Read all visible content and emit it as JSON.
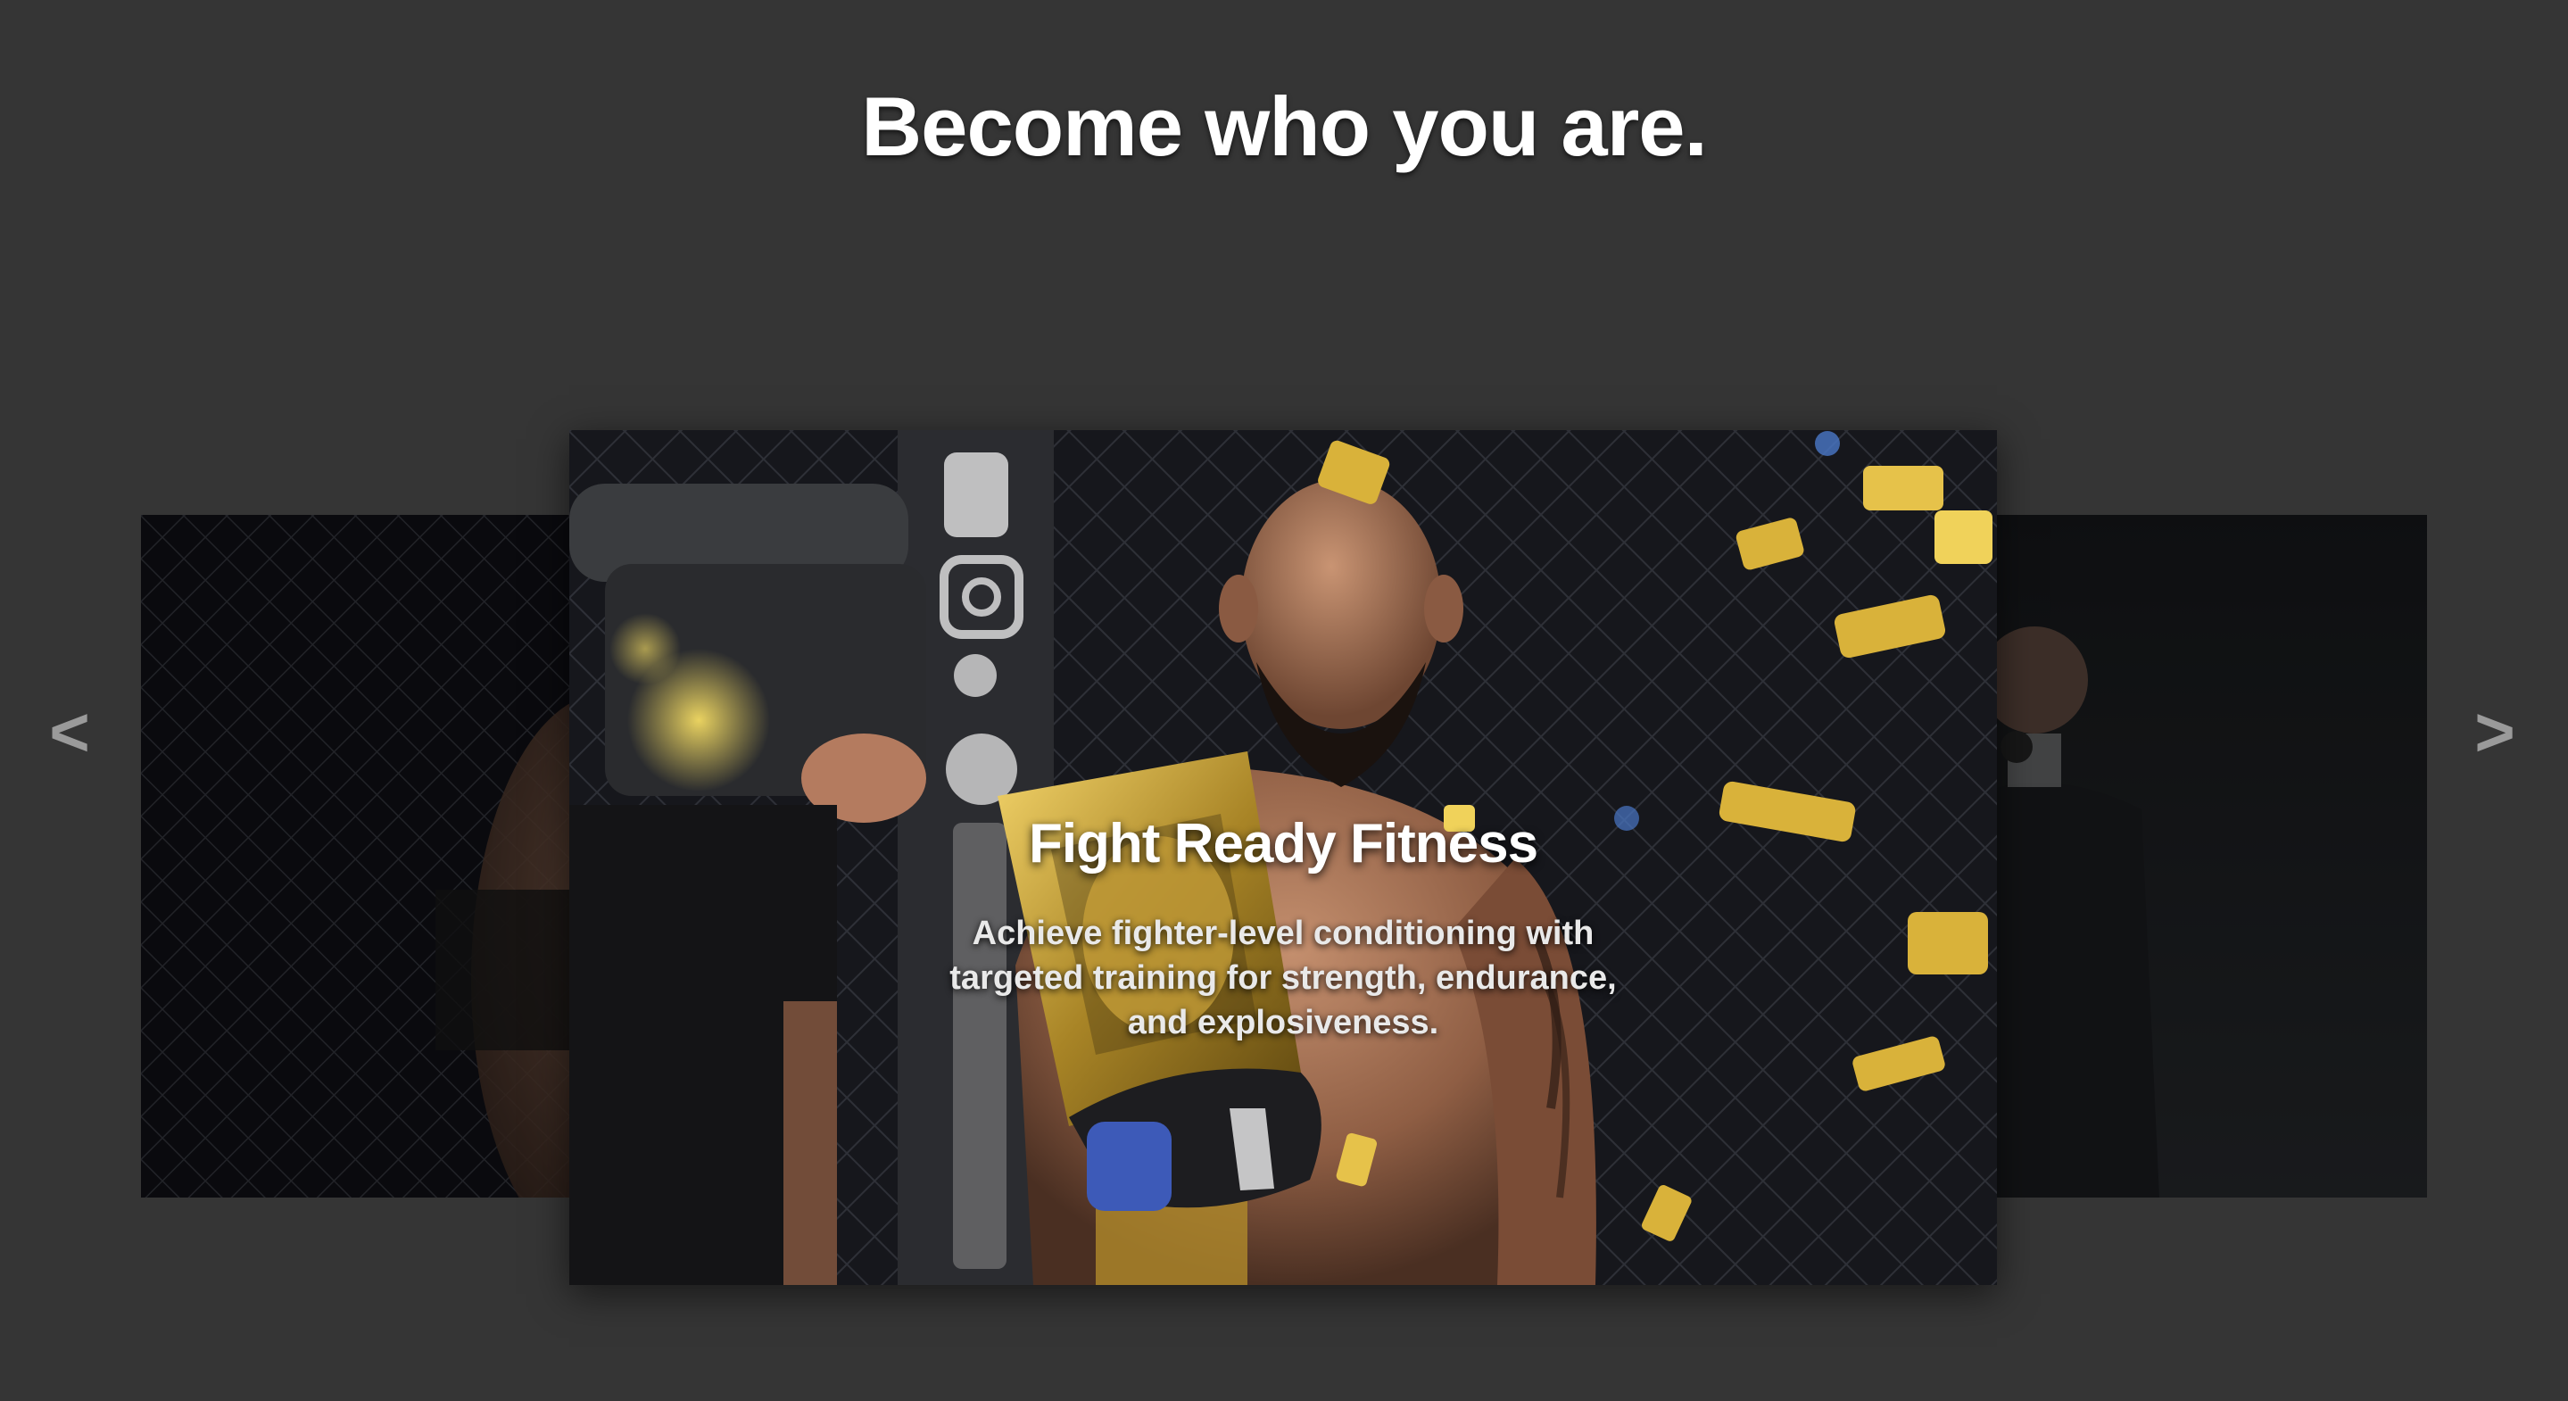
{
  "hero": {
    "headline": "Become who you are."
  },
  "carousel": {
    "prev_label": "<",
    "next_label": ">",
    "current_slide": {
      "title": "Fight Ready Fitness",
      "description": "Achieve fighter-level conditioning with targeted training for strength, endurance, and explosiveness."
    }
  },
  "colors": {
    "background": "#353535",
    "text": "#ffffff",
    "arrow": "#9a9a9a",
    "accent_gold": "#d9b23a"
  },
  "icons": [
    "chevron-left-icon",
    "chevron-right-icon"
  ]
}
